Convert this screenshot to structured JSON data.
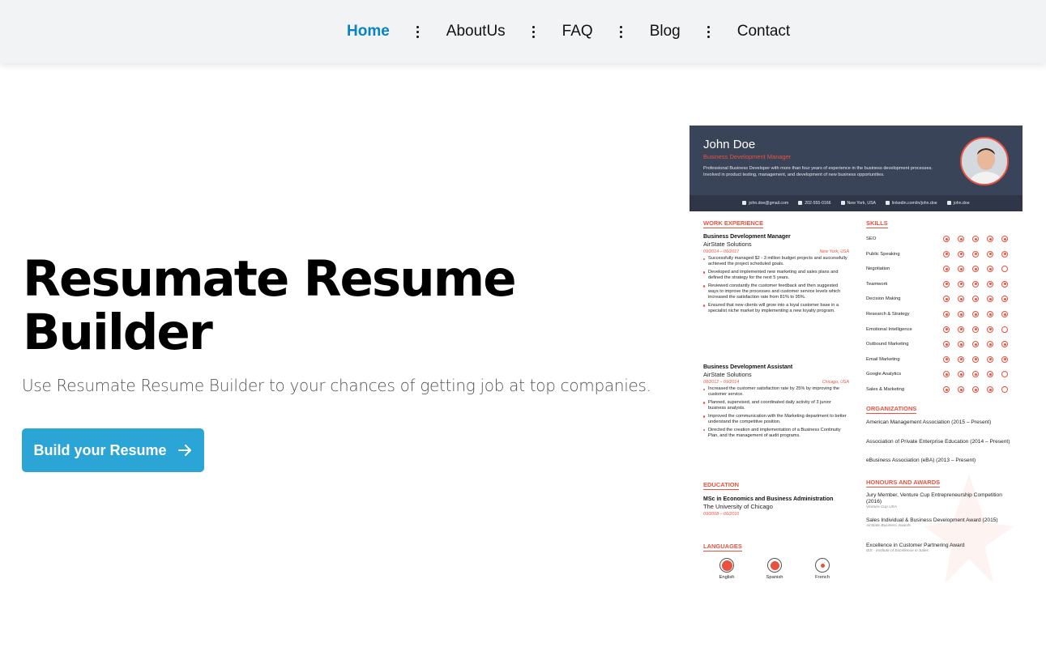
{
  "nav": {
    "items": [
      {
        "label": "Home",
        "active": true
      },
      {
        "label": "AboutUs",
        "active": false
      },
      {
        "label": "FAQ",
        "active": false
      },
      {
        "label": "Blog",
        "active": false
      },
      {
        "label": "Contact",
        "active": false
      }
    ],
    "active_color": "#0a83c1"
  },
  "hero": {
    "title": "Resumate Resume Builder",
    "subtitle": "Use Resumate Resume Builder to your chances of getting job at top companies.",
    "cta_label": "Build your Resume",
    "cta_icon": "arrow-right-icon",
    "cta_color": "#2ba4d6"
  },
  "resume": {
    "name": "John Doe",
    "role": "Business Development Manager",
    "summary": "Professional Business Developer with more than four years of experience in the business development processes. Involved in product testing, management, and development of new business opportunities.",
    "contact": {
      "email": "john.doe@gmail.com",
      "phone": "202-555-0166",
      "location": "New York, USA",
      "linkedin": "linkedin.com/in/john.doe",
      "skype": "john.doe"
    },
    "sections": {
      "work": "WORK EXPERIENCE",
      "skills": "SKILLS",
      "organizations": "ORGANIZATIONS",
      "awards": "HONOURS AND AWARDS",
      "education": "EDUCATION",
      "languages": "LANGUAGES"
    },
    "jobs": [
      {
        "title": "Business Development Manager",
        "company": "AirState Solutions",
        "dates": "09/2014 – 06/2017",
        "location": "New York, USA",
        "bullets": [
          "Successfully managed $2 - 3 million budget projects and successfully achieved the project scheduled goals.",
          "Developed and implemented new marketing and sales plans and defined the strategy for the next 5 years.",
          "Reviewed constantly the customer feedback and then suggested ways to improve the processes and customer service levels which increased the satisfaction rate from 81% to 95%.",
          "Ensured that new clients will grow into a loyal customer base in a specialist niche market by implementing a new loyalty program."
        ]
      },
      {
        "title": "Business Development Assistant",
        "company": "AirState Solutions",
        "dates": "08/2012 – 09/2014",
        "location": "Chicago, USA",
        "bullets": [
          "Increased the customer satisfaction rate by 25% by improving the customer service.",
          "Planned, supervised, and coordinated daily activity of 3 junior business analysts.",
          "Improved the communication with the Marketing department to better understand the competitive position.",
          "Directed the creation and implementation of a Business Continuity Plan, and the management of audit programs."
        ]
      }
    ],
    "skills": [
      {
        "name": "SEO",
        "level": 5
      },
      {
        "name": "Public Speaking",
        "level": 5
      },
      {
        "name": "Negotiation",
        "level": 4
      },
      {
        "name": "Teamwork",
        "level": 5
      },
      {
        "name": "Decision Making",
        "level": 5
      },
      {
        "name": "Research & Strategy",
        "level": 5
      },
      {
        "name": "Emotional Intelligence",
        "level": 4
      },
      {
        "name": "Outbound Marketing",
        "level": 5
      },
      {
        "name": "Email Marketing",
        "level": 5
      },
      {
        "name": "Google Analytics",
        "level": 4
      },
      {
        "name": "Sales & Marketing",
        "level": 4
      }
    ],
    "organizations": [
      "American Management Association (2015 – Present)",
      "Association of Private Enterprise Education (2014 – Present)",
      "eBusiness Association (eBA) (2013 – Present)"
    ],
    "awards": [
      {
        "title": "Jury Member, Venture Cup Entrepreneurship Competition (2016)",
        "source": "Venture Cup USA"
      },
      {
        "title": "Sales Individual & Business Development Award (2015)",
        "source": "AirState Business Awards"
      },
      {
        "title": "Excellence in Customer Partnering Award",
        "source": "IES - Institute of Excellence in Sales"
      }
    ],
    "education": {
      "degree": "MSc in Economics and Business Administration",
      "school": "The University of Chicago",
      "dates": "09/2008 – 06/2010"
    },
    "languages": [
      {
        "name": "English",
        "level": 1.0
      },
      {
        "name": "Spanish",
        "level": 0.8
      },
      {
        "name": "French",
        "level": 0.4
      }
    ],
    "accent_color": "#e8523f",
    "header_color": "#3a4458"
  }
}
